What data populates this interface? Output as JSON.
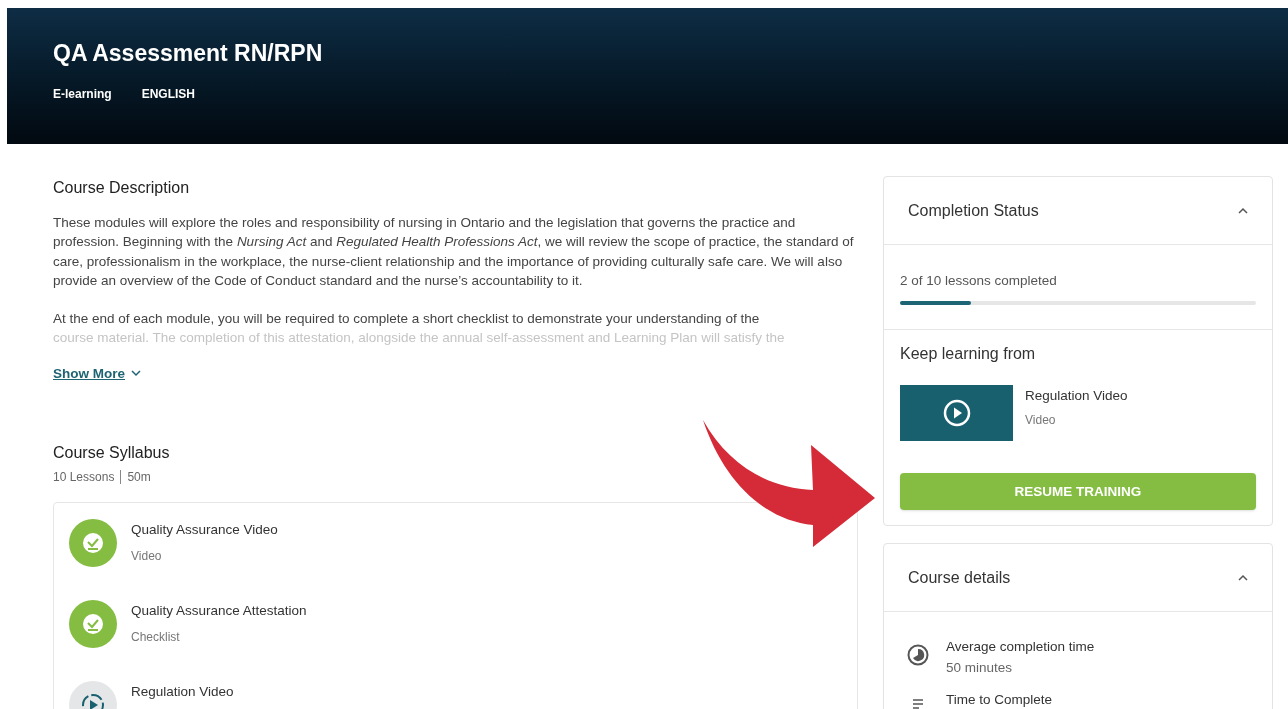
{
  "header": {
    "title": "QA Assessment RN/RPN",
    "tags": [
      "E-learning",
      "ENGLISH"
    ]
  },
  "description": {
    "heading": "Course Description",
    "paragraphs": [
      "These modules will explore the roles and responsibility of nursing in Ontario and the legislation that governs the practice and profession. Beginning with the *Nursing Act* and *Regulated Health Professions Act*, we will review the scope of practice, the standard of care, professionalism in the workplace, the nurse-client relationship and the importance of providing culturally safe care. We will also provide an overview of the Code of Conduct standard and the nurse’s accountability to it.",
      " At the end of each module, you will be required to complete a short checklist to demonstrate your understanding of the",
      "course material. The completion of this attestation, alongside the annual self-assessment and Learning Plan will satisfy the"
    ],
    "show_more": "Show More"
  },
  "syllabus": {
    "heading": "Course Syllabus",
    "lessons_count": "10 Lessons",
    "duration": "50m",
    "lessons": [
      {
        "title": "Quality Assurance Video",
        "type": "Video",
        "completed": true
      },
      {
        "title": "Quality Assurance Attestation",
        "type": "Checklist",
        "completed": true
      },
      {
        "title": "Regulation Video",
        "completed": false
      }
    ]
  },
  "completion": {
    "heading": "Completion Status",
    "expanded": true,
    "progress_text": "2 of 10 lessons completed",
    "level": 0.2,
    "keep_learning_heading": "Keep learning from",
    "next_lesson": {
      "title": "Regulation Video",
      "type": "Video"
    },
    "button": "RESUME TRAINING"
  },
  "course_details": {
    "heading": "Course details",
    "expanded": true,
    "items": [
      {
        "kind": "time",
        "label": "Average completion time",
        "value": "50 minutes"
      },
      {
        "kind": "list",
        "label": "Time to Complete"
      }
    ]
  }
}
